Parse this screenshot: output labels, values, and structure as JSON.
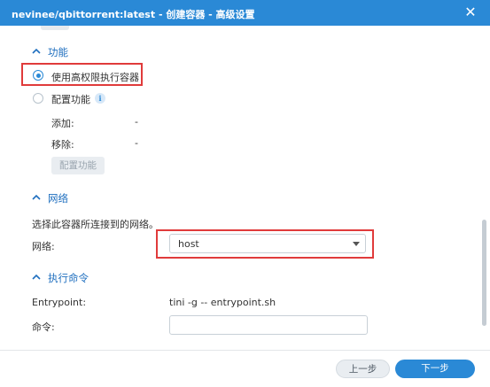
{
  "window": {
    "title": "nevinee/qbittorrent:latest - 创建容器 - 高级设置",
    "close_label": "✕"
  },
  "features": {
    "section_title": "功能",
    "privileged_label": "使用高权限执行容器",
    "configure_label": "配置功能",
    "add_label": "添加:",
    "add_value": "-",
    "remove_label": "移除:",
    "remove_value": "-",
    "configure_button": "配置功能",
    "info_icon_text": "i"
  },
  "network": {
    "section_title": "网络",
    "description": "选择此容器所连接到的网络。",
    "field_label": "网络:",
    "selected": "host"
  },
  "command": {
    "section_title": "执行命令",
    "entrypoint_label": "Entrypoint:",
    "entrypoint_value": "tini -g -- entrypoint.sh",
    "command_label": "命令:",
    "command_value": ""
  },
  "footer": {
    "prev_label": "上一步",
    "next_label": "下一步"
  },
  "colors": {
    "accent": "#2a89d6",
    "highlight": "#e03b3b"
  }
}
